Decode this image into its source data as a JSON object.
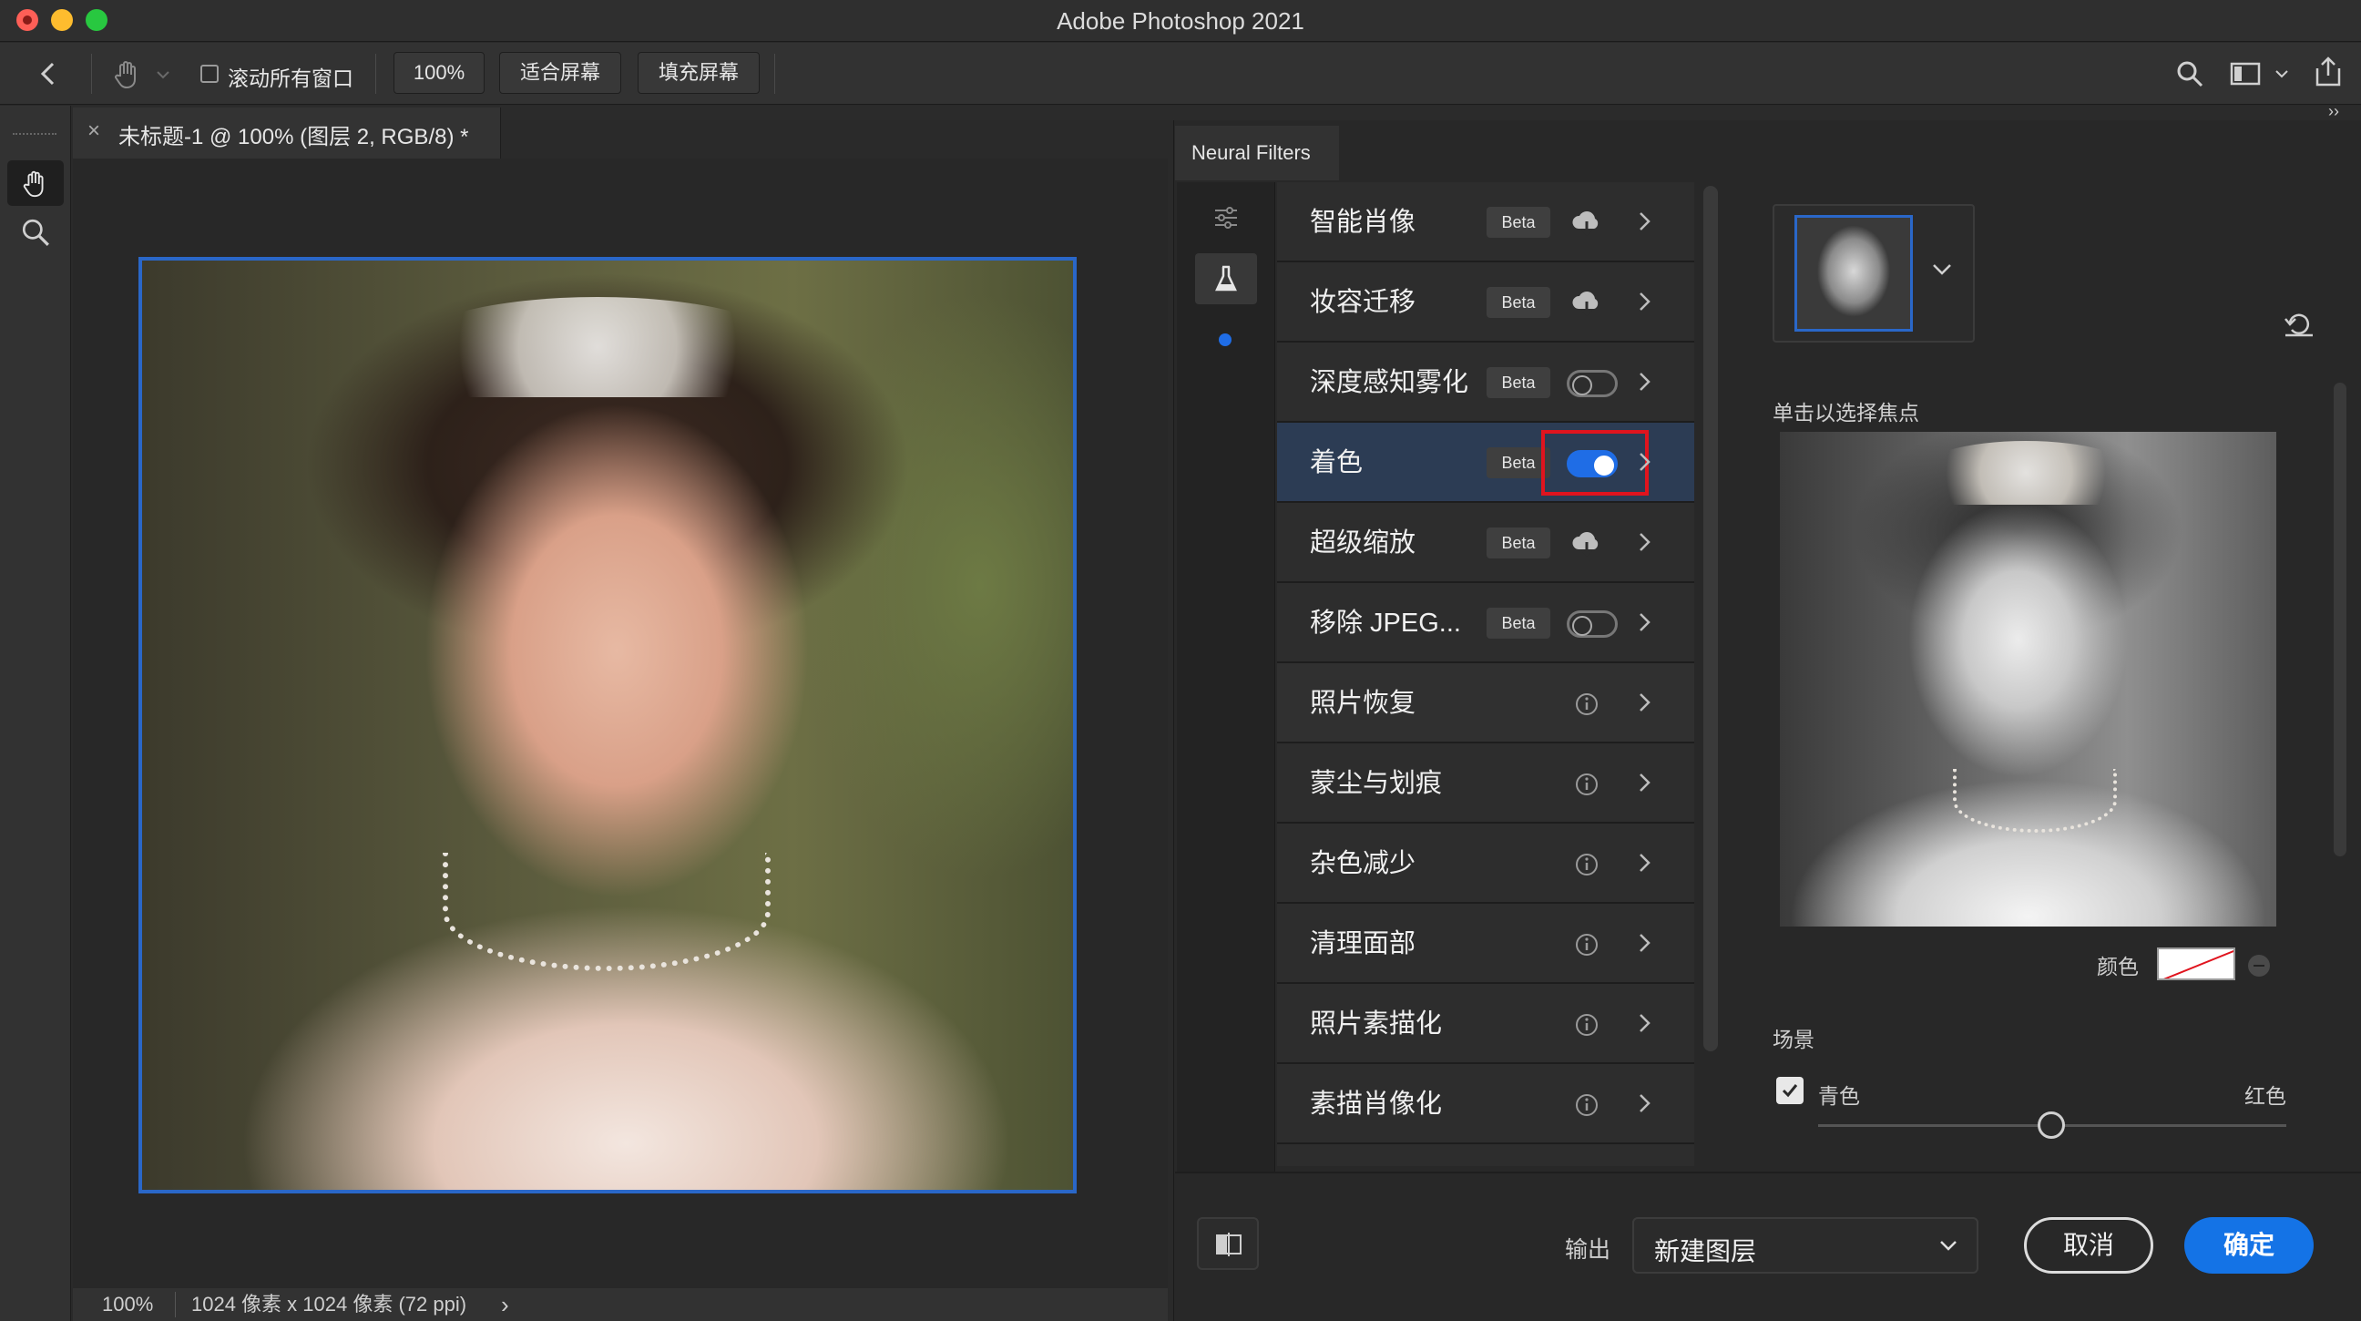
{
  "window": {
    "title": "Adobe Photoshop 2021"
  },
  "options_bar": {
    "scroll_all_label": "滚动所有窗口",
    "zoom_100": "100%",
    "fit_screen": "适合屏幕",
    "fill_screen": "填充屏幕"
  },
  "document": {
    "tab_title": "未标题-1 @ 100% (图层 2, RGB/8) *",
    "close_glyph": "×",
    "status_zoom": "100%",
    "status_info": "1024 像素 x 1024 像素 (72 ppi)",
    "status_more": "›"
  },
  "collapse": {
    "left": "››",
    "right": "››"
  },
  "neural_filters": {
    "tab_label": "Neural Filters",
    "filters": [
      {
        "name": "智能肖像",
        "badge": "Beta",
        "control": "cloud-download-icon"
      },
      {
        "name": "妆容迁移",
        "badge": "Beta",
        "control": "cloud-download-icon"
      },
      {
        "name": "深度感知雾化",
        "badge": "Beta",
        "control": "toggle-off"
      },
      {
        "name": "着色",
        "badge": "Beta",
        "control": "toggle-on"
      },
      {
        "name": "超级缩放",
        "badge": "Beta",
        "control": "cloud-download-icon"
      },
      {
        "name": "移除 JPEG...",
        "badge": "Beta",
        "control": "toggle-off"
      },
      {
        "name": "照片恢复",
        "badge": "",
        "control": "info-icon"
      },
      {
        "name": "蒙尘与划痕",
        "badge": "",
        "control": "info-icon"
      },
      {
        "name": "杂色减少",
        "badge": "",
        "control": "info-icon"
      },
      {
        "name": "清理面部",
        "badge": "",
        "control": "info-icon"
      },
      {
        "name": "照片素描化",
        "badge": "",
        "control": "info-icon"
      },
      {
        "name": "素描肖像化",
        "badge": "",
        "control": "info-icon"
      }
    ],
    "settings": {
      "focus_label": "单击以选择焦点",
      "color_label": "颜色",
      "scene_label": "场景",
      "cyan_label": "青色",
      "red_label": "红色",
      "slider_value": 0.5
    },
    "footer": {
      "output_label": "输出",
      "output_value": "新建图层",
      "cancel": "取消",
      "ok": "确定"
    }
  },
  "colors": {
    "accent": "#1473e6",
    "highlight_box": "#e0141e",
    "selection_border": "#2a67c8"
  }
}
